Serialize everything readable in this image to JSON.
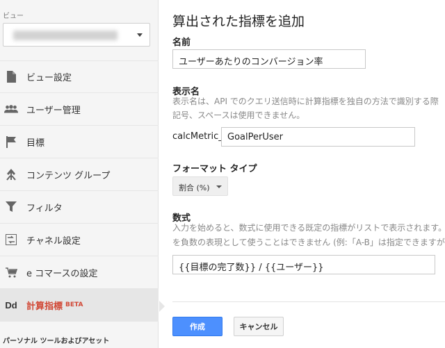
{
  "sidebar": {
    "view_label": "ビュー",
    "nav": [
      {
        "label": "ビュー設定",
        "icon": "document-icon"
      },
      {
        "label": "ユーザー管理",
        "icon": "users-icon"
      },
      {
        "label": "目標",
        "icon": "flag-icon"
      },
      {
        "label": "コンテンツ グループ",
        "icon": "content-group-icon"
      },
      {
        "label": "フィルタ",
        "icon": "filter-icon"
      },
      {
        "label": "チャネル設定",
        "icon": "channel-icon"
      },
      {
        "label": "e コマースの設定",
        "icon": "cart-icon"
      },
      {
        "label": "計算指標",
        "badge": "BETA",
        "icon_text": "Dd",
        "active": true
      }
    ],
    "section_footer": "パーソナル ツールおよびアセット"
  },
  "main": {
    "title": "算出された指標を追加",
    "name_label": "名前",
    "name_value": "ユーザーあたりのコンバージョン率",
    "display_label": "表示名",
    "display_help_1": "表示名は、API でのクエリ送信時に計算指標を独自の方法で識別する際",
    "display_help_2": "記号、スペースは使用できません。",
    "prefix": "calcMetric_",
    "display_value": "GoalPerUser",
    "format_label": "フォーマット タイプ",
    "format_value": "割合 (%)",
    "formula_label": "数式",
    "formula_help_1": "入力を始めると、数式に使用できる既定の指標がリストで表示されます。",
    "formula_help_2": "を負数の表現として使うことはできません (例:「A-B」は指定できますが、",
    "formula_value": "{{目標の完了数}} / {{ユーザー}}",
    "create_label": "作成",
    "cancel_label": "キャンセル"
  },
  "colors": {
    "accent_red": "#d14836",
    "primary_blue": "#4d90fe"
  }
}
